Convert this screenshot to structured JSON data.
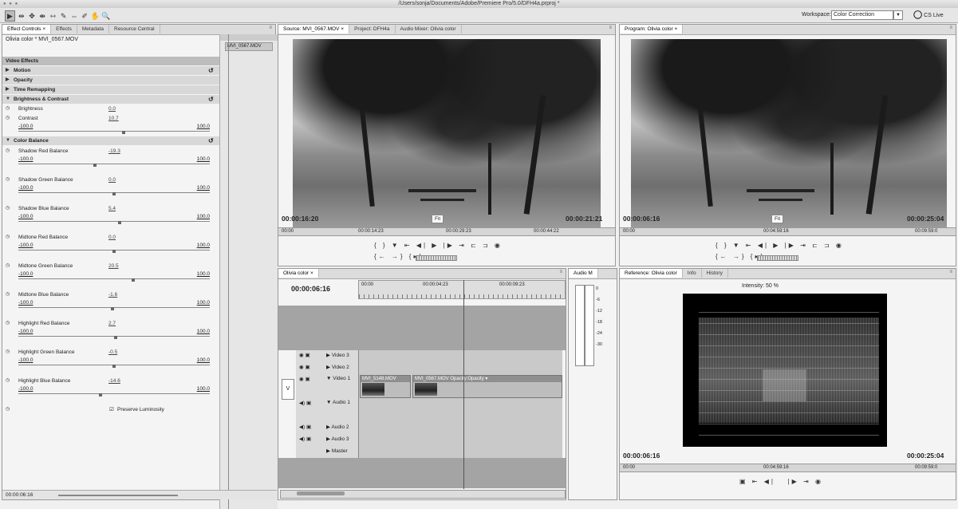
{
  "window": {
    "title": "/Users/sonja/Documents/Adobe/Premiere Pro/5.0/DFH4a.prproj *",
    "traffic_lights": "● ● ●"
  },
  "toolbar": {
    "tools": [
      "▶",
      "⇹",
      "✥",
      "⇼",
      "⇿",
      "✎",
      "⇔",
      "✐",
      "✋",
      "🔍"
    ],
    "workspace_label": "Workspace:",
    "workspace_value": "Color Correction",
    "cs_live": "CS Live"
  },
  "effect_panel": {
    "tabs": [
      "Effect Controls ×",
      "Effects",
      "Metadata",
      "Resource Central"
    ],
    "clip_label": "Olivia color * MVI_0567.MOV",
    "video_effects": "Video Effects",
    "timeline_clip": "MVI_0567.MOV",
    "effects": [
      {
        "name": "Motion",
        "reset": "↺"
      },
      {
        "name": "Opacity",
        "reset": ""
      },
      {
        "name": "Time Remapping",
        "reset": ""
      },
      {
        "name": "Brightness & Contrast",
        "reset": "↺"
      }
    ],
    "bc_params": [
      {
        "name": "Brightness",
        "value": "0.0"
      },
      {
        "name": "Contrast",
        "value": "10.7",
        "min": "-100.0",
        "max": "100.0",
        "level": 0.55
      }
    ],
    "color_balance": "Color Balance",
    "cb_reset": "↺",
    "cb_params": [
      {
        "name": "Shadow Red Balance",
        "value": "-19.3",
        "min": "-100.0",
        "max": "100.0",
        "level": 0.4
      },
      {
        "name": "Shadow Green Balance",
        "value": "0.0",
        "min": "-100.0",
        "max": "100.0",
        "level": 0.5
      },
      {
        "name": "Shadow Blue Balance",
        "value": "5.4",
        "min": "-100.0",
        "max": "100.0",
        "level": 0.53
      },
      {
        "name": "Midtone Red Balance",
        "value": "0.0",
        "min": "-100.0",
        "max": "100.0",
        "level": 0.5
      },
      {
        "name": "Midtone Green Balance",
        "value": "20.5",
        "min": "-100.0",
        "max": "100.0",
        "level": 0.6
      },
      {
        "name": "Midtone Blue Balance",
        "value": "-1.6",
        "min": "-100.0",
        "max": "100.0",
        "level": 0.49
      },
      {
        "name": "Highlight Red Balance",
        "value": "2.7",
        "min": "-100.0",
        "max": "100.0",
        "level": 0.51
      },
      {
        "name": "Highlight Green Balance",
        "value": "-0.5",
        "min": "-100.0",
        "max": "100.0",
        "level": 0.5
      },
      {
        "name": "Highlight Blue Balance",
        "value": "-14.6",
        "min": "-100.0",
        "max": "100.0",
        "level": 0.43
      }
    ],
    "preserve_luminosity": "Preserve Luminosity",
    "footer_time": "00:00:06:16"
  },
  "source_monitor": {
    "tabs": [
      "Source: MVI_0567.MOV ×",
      "Project: DFH4a",
      "Audio Mixer: Olivia color"
    ],
    "timecode_left": "00:00:16:20",
    "fit": "Fit",
    "timecode_right": "00:00:21:21",
    "ruler": [
      "00:00",
      "00:00:14:23",
      "00:00:29:23",
      "00:00:44:22"
    ],
    "controls_row1": "{ } ▼ ⇤ ◀| ▶ |▶ ⇥ ⊏ ⊐ ◉",
    "controls_row2": "{← →} {▸}"
  },
  "program_monitor": {
    "tabs": [
      "Program: Olivia color ×"
    ],
    "timecode_left": "00:00:06:16",
    "fit": "Fit",
    "timecode_right": "00:00:25:04",
    "ruler": [
      "00:00",
      "00:04:59:16",
      "00:09:59:0"
    ],
    "controls_row1": "{ } ▼ ⇤ ◀| ▶ |▶ ⇥ ⊏ ⊐ ◉",
    "controls_row2": "{← →} {▸}"
  },
  "timeline": {
    "tabs": [
      "Olivia color ×"
    ],
    "time": "00:00:06:16",
    "ruler": [
      "00:00",
      "00:00:04:23",
      "00:00:09:23"
    ],
    "tracks": [
      {
        "name": "Video 3"
      },
      {
        "name": "Video 2"
      },
      {
        "name": "Video 1"
      },
      {
        "name": "Audio 1"
      },
      {
        "name": "Audio 2"
      },
      {
        "name": "Audio 3"
      },
      {
        "name": "Master"
      }
    ],
    "v_label": "V",
    "clip1": "MVI_5148.MOV",
    "clip2": "MVI_0567.MOV Opacity:Opacity ▾"
  },
  "audio_meter": {
    "tab": "Audio M",
    "labels": [
      "0",
      "-6",
      "-12",
      "-18",
      "-24",
      "-30"
    ]
  },
  "reference_monitor": {
    "tabs": [
      "Reference: Olivia color",
      "Info",
      "History"
    ],
    "intensity_label": "Intensity:",
    "intensity_value": "50 %",
    "timecode_left": "00:00:06:16",
    "timecode_right": "00:00:25:04",
    "ruler": [
      "00:00",
      "00:04:59:16",
      "00:09:59:0"
    ]
  }
}
